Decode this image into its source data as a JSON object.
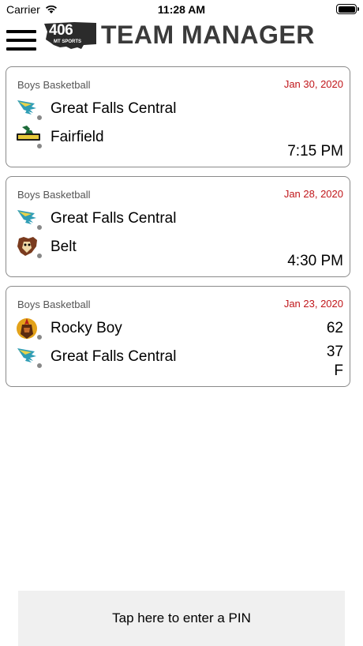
{
  "status_bar": {
    "carrier": "Carrier",
    "time": "11:28 AM"
  },
  "header": {
    "logo_number": "406",
    "logo_sub": "MT SPORTS",
    "title": "TEAM MANAGER"
  },
  "games": [
    {
      "sport": "Boys Basketball",
      "date": "Jan 30, 2020",
      "team1": {
        "name": "Great Falls Central",
        "logo": "great-falls-central-logo-icon"
      },
      "team2": {
        "name": "Fairfield",
        "logo": "fairfield-logo-icon"
      },
      "time": "7:15 PM"
    },
    {
      "sport": "Boys Basketball",
      "date": "Jan 28, 2020",
      "team1": {
        "name": "Great Falls Central",
        "logo": "great-falls-central-logo-icon"
      },
      "team2": {
        "name": "Belt",
        "logo": "belt-logo-icon"
      },
      "time": "4:30 PM"
    },
    {
      "sport": "Boys Basketball",
      "date": "Jan 23, 2020",
      "team1": {
        "name": "Rocky Boy",
        "logo": "rocky-boy-logo-icon",
        "score": "62"
      },
      "team2": {
        "name": "Great Falls Central",
        "logo": "great-falls-central-logo-icon",
        "score": "37"
      },
      "status": "F"
    }
  ],
  "pin_button": {
    "label": "Tap here to enter a PIN"
  },
  "colors": {
    "date_red": "#c0161a",
    "card_border": "#8a8a8a",
    "pin_bg": "#f0f0f0"
  }
}
